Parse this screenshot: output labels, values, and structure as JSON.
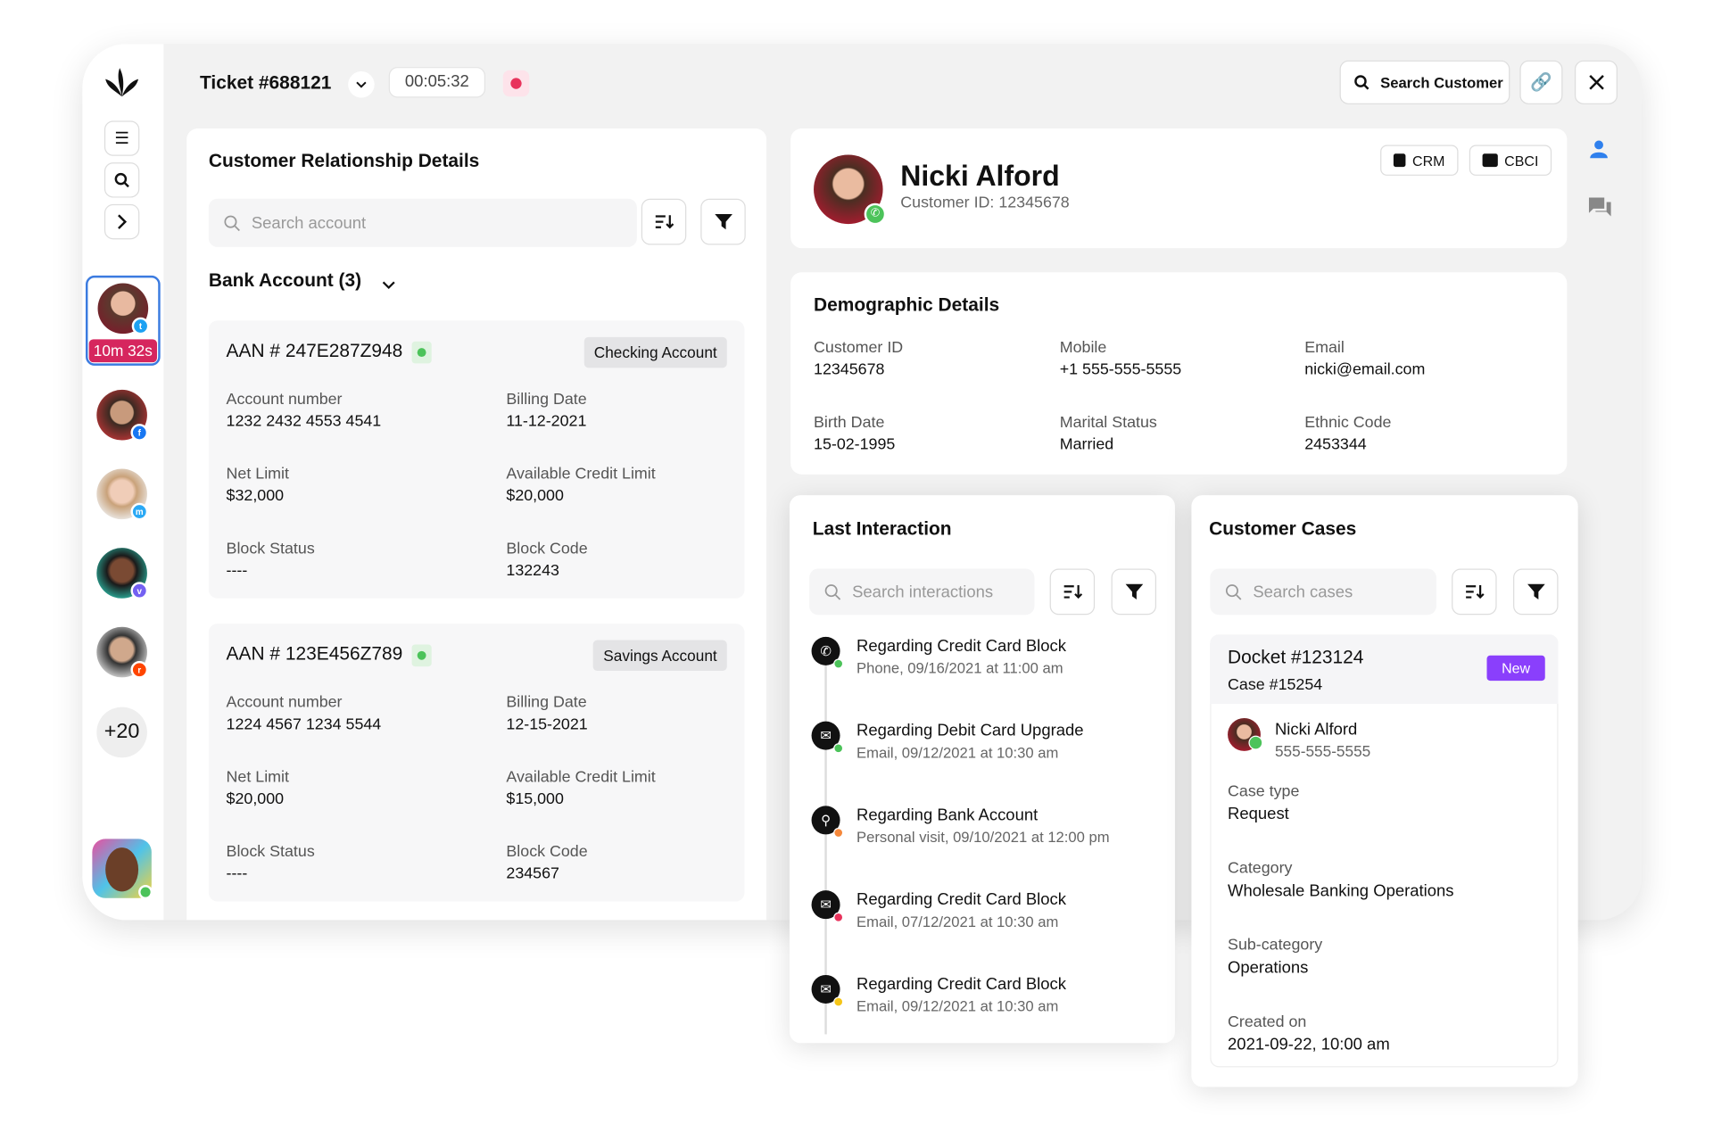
{
  "header": {
    "ticket": "Ticket #688121",
    "timer": "00:05:32",
    "search_customer": "Search Customer"
  },
  "sidebar": {
    "active_timer": "10m 32s",
    "more_count": "+20",
    "channels": [
      "twitter",
      "facebook",
      "messenger",
      "viber",
      "reddit"
    ]
  },
  "crm": {
    "title": "Customer Relationship Details",
    "search_placeholder": "Search account",
    "group": "Bank Account (3)",
    "accounts": [
      {
        "aan": "AAN # 247E287Z948",
        "type": "Checking Account",
        "account_number_label": "Account number",
        "account_number": "1232 2432 4553 4541",
        "billing_label": "Billing Date",
        "billing": "11-12-2021",
        "net_label": "Net Limit",
        "net": "$32,000",
        "avail_label": "Available Credit Limit",
        "avail": "$20,000",
        "block_status_label": "Block Status",
        "block_status": "----",
        "block_code_label": "Block Code",
        "block_code": "132243"
      },
      {
        "aan": "AAN # 123E456Z789",
        "type": "Savings Account",
        "account_number_label": "Account number",
        "account_number": "1224 4567 1234 5544",
        "billing_label": "Billing Date",
        "billing": "12-15-2021",
        "net_label": "Net Limit",
        "net": "$20,000",
        "avail_label": "Available Credit Limit",
        "avail": "$15,000",
        "block_status_label": "Block Status",
        "block_status": "----",
        "block_code_label": "Block Code",
        "block_code": "234567"
      }
    ]
  },
  "profile": {
    "name": "Nicki Alford",
    "customer_id": "Customer ID: 12345678",
    "crm_btn": "CRM",
    "cbci_btn": "CBCI"
  },
  "demographic": {
    "title": "Demographic Details",
    "fields": [
      {
        "label": "Customer ID",
        "value": "12345678"
      },
      {
        "label": "Mobile",
        "value": "+1 555-555-5555"
      },
      {
        "label": "Email",
        "value": "nicki@email.com"
      },
      {
        "label": "Birth Date",
        "value": "15-02-1995"
      },
      {
        "label": "Marital Status",
        "value": "Married"
      },
      {
        "label": "Ethnic Code",
        "value": "2453344"
      }
    ]
  },
  "interactions": {
    "title": "Last Interaction",
    "search_placeholder": "Search interactions",
    "items": [
      {
        "title": "Regarding Credit Card Block",
        "sub": "Phone, 09/16/2021 at 11:00 am",
        "icon": "phone",
        "dot": "#4cc35a"
      },
      {
        "title": "Regarding Debit Card Upgrade",
        "sub": "Email, 09/12/2021 at 10:30 am",
        "icon": "mail",
        "dot": "#4cc35a"
      },
      {
        "title": "Regarding Bank Account",
        "sub": "Personal visit, 09/10/2021 at 12:00 pm",
        "icon": "location",
        "dot": "#f5883b"
      },
      {
        "title": "Regarding Credit Card Block",
        "sub": "Email, 07/12/2021 at 10:30 am",
        "icon": "mail",
        "dot": "#e8335c"
      },
      {
        "title": "Regarding Credit Card Block",
        "sub": "Email, 09/12/2021 at 10:30 am",
        "icon": "mail",
        "dot": "#f5c518"
      }
    ]
  },
  "cases": {
    "title": "Customer Cases",
    "search_placeholder": "Search cases",
    "docket": "Docket #123124",
    "case": "Case #15254",
    "status": "New",
    "status_color": "#8a3ffc",
    "name": "Nicki Alford",
    "phone": "555-555-5555",
    "fields": [
      {
        "label": "Case type",
        "value": "Request"
      },
      {
        "label": "Category",
        "value": "Wholesale Banking Operations"
      },
      {
        "label": "Sub-category",
        "value": "Operations"
      },
      {
        "label": "Created on",
        "value": "2021-09-22, 10:00 am"
      }
    ]
  }
}
